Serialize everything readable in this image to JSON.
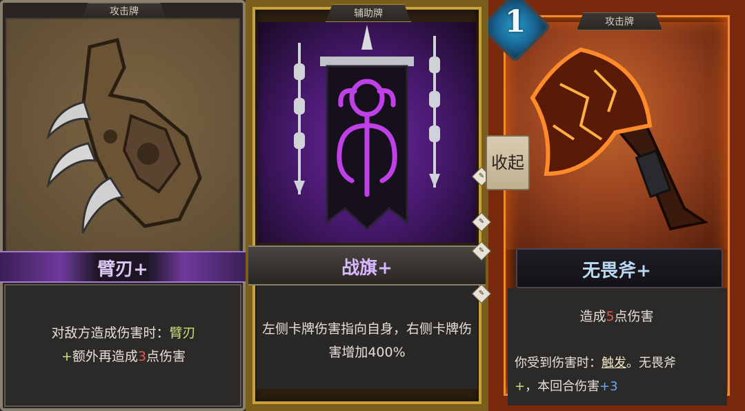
{
  "cards": [
    {
      "type_label": "攻击牌",
      "name": "臂刃",
      "upgrade": "+",
      "desc": {
        "text1": "对敌方造成伤害时：",
        "card_ref": "臂刃",
        "plus": "+",
        "text2": "额外再造成",
        "value": "3",
        "text3": "点伤害"
      }
    },
    {
      "type_label": "辅助牌",
      "name": "战旗",
      "upgrade": "+",
      "desc": {
        "text": "左侧卡牌伤害指向自身，右侧卡牌伤害增加400%"
      }
    },
    {
      "type_label": "攻击牌",
      "cost": "1",
      "name": "无畏斧",
      "upgrade": "+",
      "desc": {
        "line1_a": "造成",
        "line1_value": "5",
        "line1_b": "点伤害",
        "line2_a": "你受到伤害时：",
        "keyword": "触发",
        "sep": "。",
        "card_ref": "无畏斧",
        "plus": "+",
        "line2_b": "，本回合伤害",
        "bonus": "+3"
      }
    }
  ],
  "collapse_button": "收起",
  "colors": {
    "upgrade_green": "#cce07a",
    "value_red": "#e85a4a",
    "bonus_blue": "#6aa8f0",
    "name_purple": "#dcc6f2",
    "name_blue": "#b9d8f2"
  }
}
